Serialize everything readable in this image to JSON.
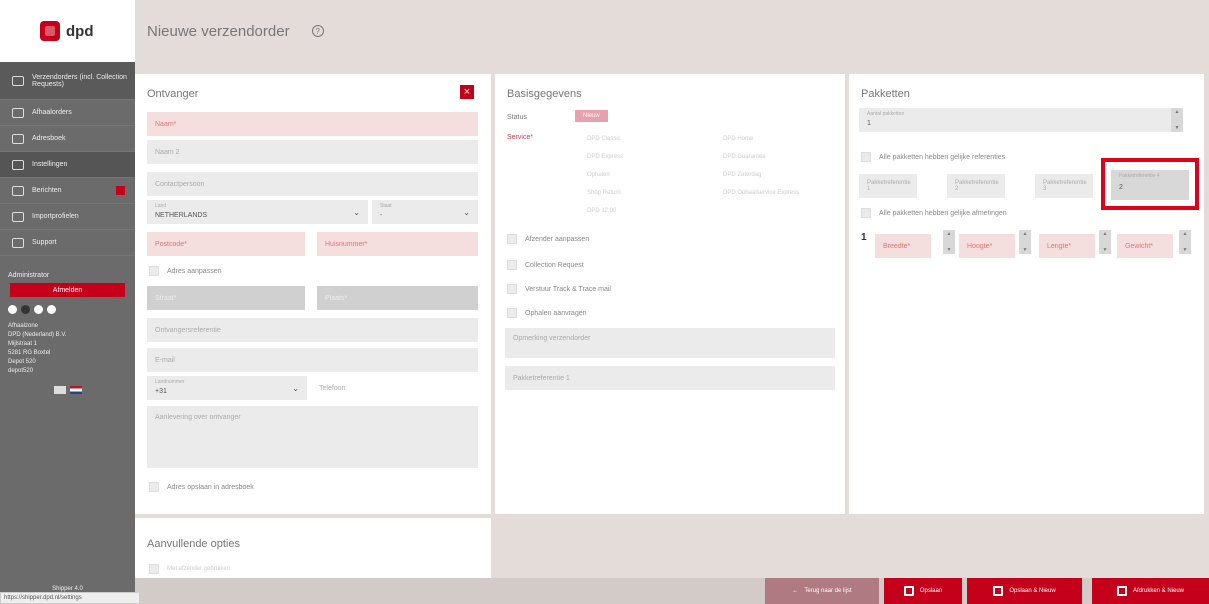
{
  "sidebar": {
    "brand": "dpd",
    "items": [
      {
        "label": "Verzendorders (incl. Collection Requests)"
      },
      {
        "label": "Afhaalorders"
      },
      {
        "label": "Adresboek"
      },
      {
        "label": "Instellingen"
      },
      {
        "label": "Berichten"
      },
      {
        "label": "Importprofielen"
      },
      {
        "label": "Support"
      }
    ],
    "admin_title": "Administrator",
    "admin_button": "Afmelden",
    "address_lines": [
      "Afhaalzone",
      "DPD (Nederland) B.V.",
      "Mijlstraat 1",
      "5281 RG Boxtel",
      "Depot 520",
      "depot520"
    ],
    "version": "Shipper 4.0"
  },
  "header": {
    "title": "Nieuwe verzendorder",
    "help_icon": "question-circle-icon"
  },
  "ontvanger": {
    "title": "Ontvanger",
    "naam": "Naam*",
    "naam2": "Naam 2",
    "contactpersoon": "Contactpersoon",
    "land_label": "Land",
    "land_value": "NETHERLANDS",
    "staat_label": "Staat",
    "staat_value": "-",
    "postcode": "Postcode*",
    "huisnummer": "Huisnummer*",
    "adres_aanpassen": "Adres aanpassen",
    "straat": "Straat*",
    "plaats": "Plaats*",
    "ontvangersreferentie": "Ontvangersreferentie",
    "email": "E-mail",
    "landnummer_label": "Landnummer",
    "landnummer_value": "+31",
    "telefoon": "Telefoon",
    "aanlevering": "Aanlevering over ontvanger",
    "opslaan_adresboek": "Adres opslaan in adresboek"
  },
  "aanvullende": {
    "title": "Aanvullende opties",
    "sub": "Met afzender gebruiken"
  },
  "basis": {
    "title": "Basisgegevens",
    "status_label": "Status",
    "status_value": "Nieuw",
    "service_label": "Service*",
    "services": [
      "DPD Classic",
      "DPD Home",
      "DPD Express",
      "DPD Guarantee",
      "Ophalen",
      "DPD Zaterdag",
      "Shop Return",
      "DPD Ophaalservice Express",
      "DPD 12:00"
    ],
    "checks": [
      "Afzender aanpassen",
      "Collection Request",
      "Verstuur Track & Trace mail",
      "Ophalen aanvragen"
    ],
    "opmerking": "Opmerking verzendorder",
    "pakketreferentie": "Pakketreferentie 1"
  },
  "pakketten": {
    "title": "Pakketten",
    "aantal_label": "Aantal pakketten",
    "aantal_value": "1",
    "check1": "Alle pakketten hebben gelijke referenties",
    "refs": [
      "Pakketreferentie 1",
      "Pakketreferentie 2",
      "Pakketreferentie 3",
      "Pakketreferentie 4"
    ],
    "ref4_value": "2",
    "check2": "Alle pakketten hebben gelijke afmetingen",
    "row_num": "1",
    "dims": [
      "Breedte*",
      "Hoogte*",
      "Lengte*",
      "Gewicht*"
    ]
  },
  "footer": {
    "back": "Terug naar de lijst",
    "save": "Opslaan",
    "save_new": "Opslaan & Nieuw",
    "print_new": "Afdrukken & Nieuw"
  },
  "status_url": "https://shipper.dpd.nl/settings"
}
